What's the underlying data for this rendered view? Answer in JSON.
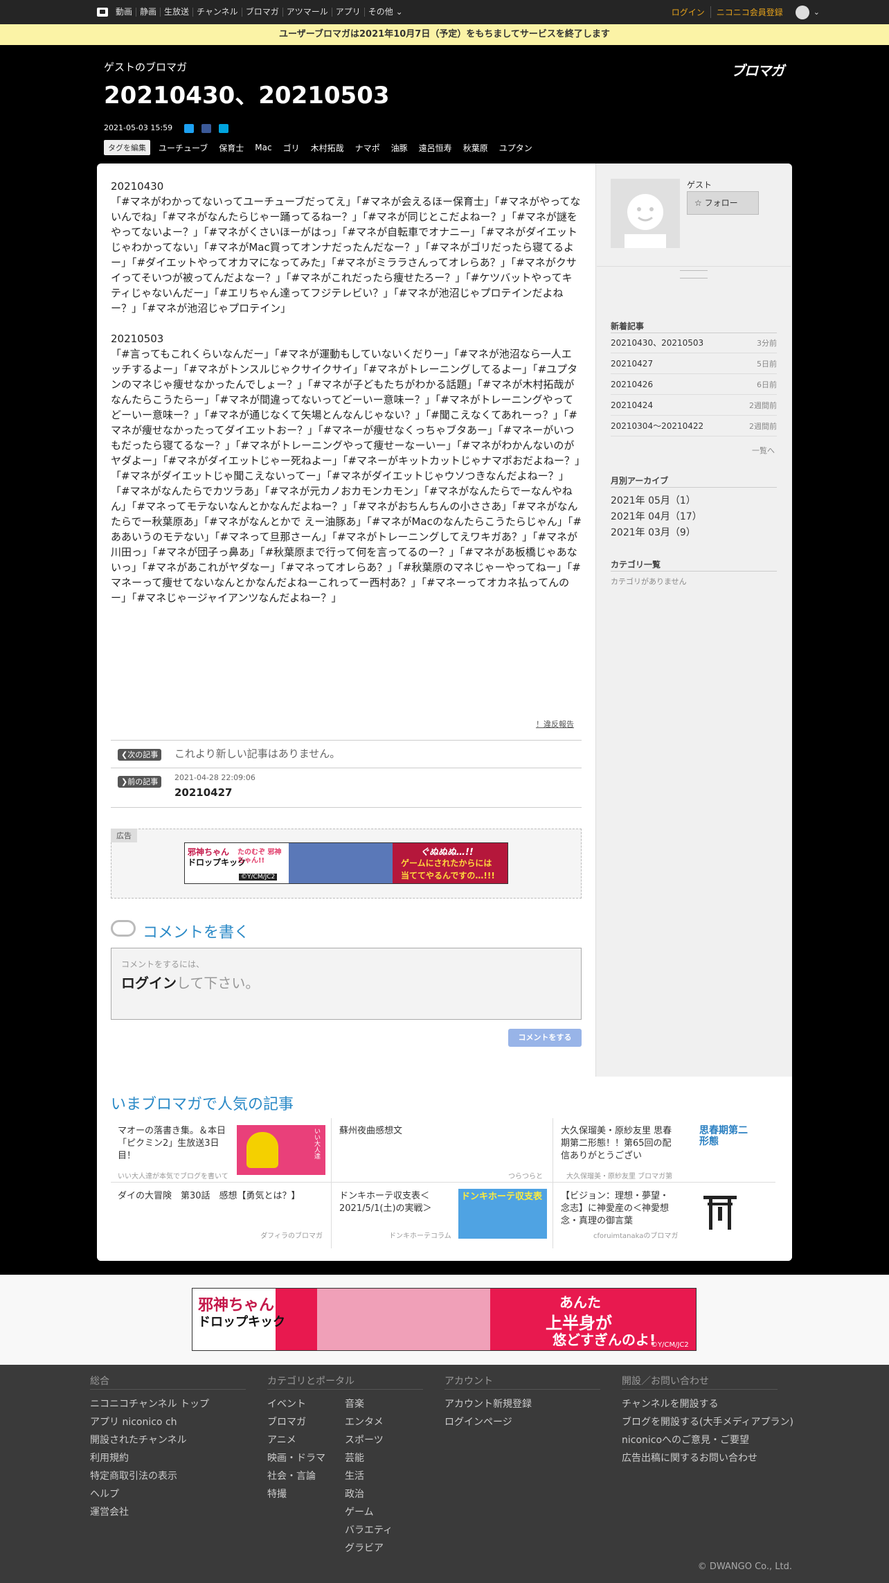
{
  "topnav": {
    "items": [
      "動画",
      "静画",
      "生放送",
      "チャンネル",
      "ブロマガ",
      "アツマール",
      "アプリ",
      "その他"
    ],
    "login": "ログイン",
    "register": "ニコニコ会員登録"
  },
  "notice": "ユーザーブロマガは2021年10月7日（予定）をもちましてサービスを終了します",
  "header": {
    "blog_name": "ゲストのブロマガ",
    "title": "20210430、20210503",
    "logo": "ブロマガ",
    "date": "2021-05-03 15:59",
    "edit_tags": "タグを編集",
    "tags": [
      "ユーチューブ",
      "保育士",
      "Mac",
      "ゴリ",
      "木村拓哉",
      "ナマポ",
      "油豚",
      "遠呂恒寿",
      "秋葉原",
      "ユプタン"
    ]
  },
  "article": {
    "body": "20210430\n「#マネがわかってないってユーチューブだってえ」「#マネが会えるほー保育士」「#マネがやってないんでね」「#マネがなんたらじゃー踊ってるねー？」「#マネが同じとこだよねー？」「#マネが謎をやってないよー？」「#マネがくさいほーがはっ」「#マネが自転車でオナニー」「#マネがダイエットじゃわかってない」「#マネがMac買ってオンナだったんだなー？」「#マネがゴリだったら寝てるよー」「#ダイエットやってオカマになってみた」「#マネがミララさんってオレらあ？」「#マネがクサイってそいつが被ってんだよなー？」「#マネがこれだったら痩せたろー？」「#ケツバットやってキティじゃないんだー」「#エリちゃん達ってフジテレビい？」「#マネが池沼じゃプロテインだよねー？」「#マネが池沼じゃプロテイン」\n\n20210503\n「#言ってもこれくらいなんだー」「#マネが運動もしていないくだりー」「#マネが池沼なら一人エッチするよー」「#マネがトンスルじゃクサイクサイ」「#マネがトレーニングしてるよー」「#ユプタンのマネじゃ痩せなかったんでしょー？」「#マネが子どもたちがわかる話題」「#マネが木村拓哉がなんたらこうたらー」「#マネが間違ってないってどーいー意味ー？」「#マネがトレーニングやってどーいー意味ー？」「#マネが通じなくて矢場とんなんじゃない？」「#聞こえなくてあれーっ？」「#マネが痩せなかったってダイエットおー？」「#マネーが痩せなくっちゃブタあー」「#マネーがいつもだったら寝てるなー？」「#マネがトレーニングやって痩せーなーいー」「#マネがわかんないのがヤダよー」「#マネがダイエットじゃー死ねよー」「#マネーがキットカットじゃナマポおだよねー？」「#マネがダイエットじゃ聞こえないってー」「#マネがダイエットじゃウソつきなんだよねー？」「#マネがなんたらでカツラあ」「#マネが元カノおカモンカモン」「#マネがなんたらでーなんやねん」「#マネってモテないなんとかなんだよねー？」「#マネがおちんちんの小ささあ」「#マネがなんたらでー秋葉原あ」「#マネがなんとかで えー油豚あ」「#マネがMacのなんたらこうたらじゃん」「#ああいうのモテない」「#マネって旦那さーん」「#マネがトレーニングしてえワキガあ？」「#マネが川田っ」「#マネが団子っ鼻あ」「#秋葉原まで行って何を言ってるのー？」「#マネがあ板橋じゃあないっ」「#マネがあこれがヤダなー」「#マネってオレらあ？」「#秋葉原のマネじゃーやってねー」「#マネーって痩せてないなんとかなんだよねーこれってー西村あ？」「#マネーってオカネ払ってんのー」「#マネじゃージャイアンツなんだよねー？」",
    "report": "！違反報告",
    "next_badge": "次の記事",
    "next_text": "これより新しい記事はありません。",
    "prev_badge": "前の記事",
    "prev_date": "2021-04-28 22:09:06",
    "prev_title": "20210427",
    "ad_label": "広告",
    "ad_banner": {
      "line1": "邪神ちゃん",
      "line2": "ドロップキック",
      "mid": "たのむぞ 邪神ちゃん!!",
      "right1": "ぐぬぬぬ…!!",
      "right2": "ゲームにされたからには",
      "right3": "当ててやるんですの…!!!",
      "copy": "©Y/CM/JC2"
    }
  },
  "comment": {
    "heading": "コメントを書く",
    "hint": "コメントをするには、",
    "login": "ログイン",
    "login_suffix": "して下さい。",
    "submit": "コメントをする"
  },
  "sidebar": {
    "user_name": "ゲスト",
    "follow": "フォロー",
    "recent_title": "新着記事",
    "recent": [
      {
        "title": "20210430、20210503",
        "ago": "3分前"
      },
      {
        "title": "20210427",
        "ago": "5日前"
      },
      {
        "title": "20210426",
        "ago": "6日前"
      },
      {
        "title": "20210424",
        "ago": "2週間前"
      },
      {
        "title": "20210304～20210422",
        "ago": "2週間前"
      }
    ],
    "list_link": "一覧へ",
    "archive_title": "月別アーカイブ",
    "archive": [
      "2021年 05月（1）",
      "2021年 04月（17）",
      "2021年 03月（9）"
    ],
    "category_title": "カテゴリ一覧",
    "category_empty": "カテゴリがありません"
  },
  "popular": {
    "title": "いまブロマガで人気の記事",
    "items": [
      {
        "title": "マオーの落書き集。＆本日「ピクミン2」生放送3日目！",
        "source": "いい大人達が本気でブログを書いて",
        "thumb": "いい大人達"
      },
      {
        "title": "蘇州夜曲感想文",
        "source": "つらつらと",
        "thumb": ""
      },
      {
        "title": "大久保瑠美・原紗友里 思春期第二形態！！第65回の配信ありがとうござい",
        "source": "大久保瑠美・原紗友里 ブロマガ第",
        "thumb": "思春期第二形態"
      },
      {
        "title": "ダイの大冒険　第30話　感想【勇気とは？】",
        "source": "ダフィラのブロマガ",
        "thumb": ""
      },
      {
        "title": "ドンキホーテ収支表＜2021/5/1(土)の実戦＞",
        "source": "ドンキホーテコラム",
        "thumb": "ドンキホーテ収支表"
      },
      {
        "title": "【ビジョン：理想・夢望・念志】に神愛産の＜神愛想念・真理の御言葉",
        "source": "cforuimtanakaのブロマガ",
        "thumb": ""
      }
    ]
  },
  "bottom_ad": {
    "line1": "邪神ちゃん",
    "line2": "ドロップキック",
    "right1": "あんた",
    "right2": "上半身が",
    "right3": "悠どすぎんのよ!",
    "copy": "©Y/CM/JC2"
  },
  "footer": {
    "col1_title": "総合",
    "col1": [
      "ニコニコチャンネル トップ",
      "アプリ niconico ch",
      "開設されたチャンネル",
      "利用規約",
      "特定商取引法の表示",
      "ヘルプ",
      "運営会社"
    ],
    "col2_title": "カテゴリとポータル",
    "col2a": [
      "イベント",
      "ブロマガ",
      "アニメ",
      "映画・ドラマ",
      "社会・言論",
      "特撮"
    ],
    "col2b": [
      "音楽",
      "エンタメ",
      "スポーツ",
      "芸能",
      "生活",
      "政治",
      "ゲーム",
      "バラエティ",
      "グラビア"
    ],
    "col3_title": "アカウント",
    "col3": [
      "アカウント新規登録",
      "ログインページ"
    ],
    "col4_title": "開設／お問い合わせ",
    "col4": [
      "チャンネルを開設する",
      "ブログを開設する(大手メディアプラン)",
      "niconicoへのご意見・ご要望",
      "広告出稿に関するお問い合わせ"
    ],
    "copyright": "© DWANGO Co., Ltd."
  }
}
